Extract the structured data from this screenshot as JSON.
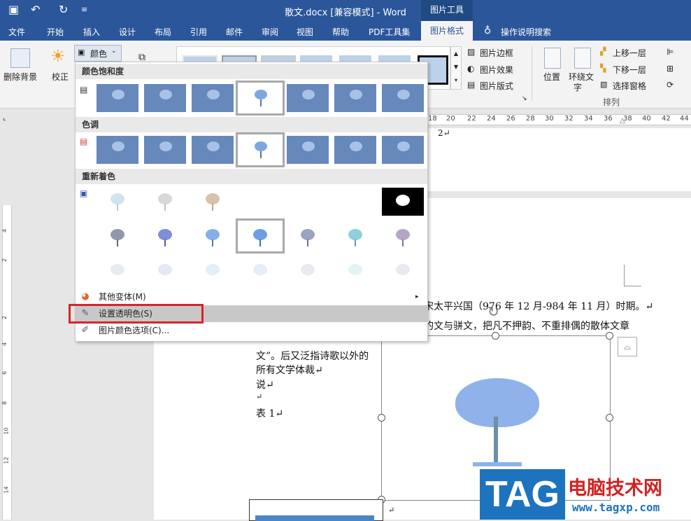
{
  "titlebar": {
    "doc_title": "散文.docx [兼容模式]  -  Word",
    "context_group": "图片工具"
  },
  "tabs": [
    "文件",
    "开始",
    "插入",
    "设计",
    "布局",
    "引用",
    "邮件",
    "审阅",
    "视图",
    "帮助",
    "PDF工具集"
  ],
  "active_tab": "图片格式",
  "tell_me": "操作说明搜索",
  "ribbon": {
    "remove_bg": "删除背景",
    "correct": "校正",
    "color": "颜色",
    "border": "图片边框",
    "effects": "图片效果",
    "layout": "图片版式",
    "position": "位置",
    "wrap_text_1": "环绕文",
    "wrap_text_2": "字",
    "bring_forward": "上移一层",
    "send_backward": "下移一层",
    "selection_pane": "选择窗格",
    "arrange_group": "排列"
  },
  "ruler_numbers": [
    "18",
    "20",
    "22",
    "24",
    "26",
    "28",
    "30",
    "32",
    "34",
    "36",
    "38",
    "40",
    "42",
    "44"
  ],
  "vruler_numbers": [
    "4",
    "2",
    "2",
    "4",
    "6",
    "8",
    "10",
    "12",
    "14"
  ],
  "dropdown": {
    "saturation_header": "颜色饱和度",
    "tone_header": "色调",
    "recolor_header": "重新着色",
    "more_variations": "其他变体(M)",
    "set_transparent": "设置透明色(S)",
    "color_options": "图片颜色选项(C)..."
  },
  "document": {
    "page_num": "2↵",
    "line1": "宋太平兴国（976 年 12 月-984 年 11 月）时期。↵",
    "line2": "的文与骈文，把凡不押韵、不重排偶的散体文章",
    "line3": "文”。后又泛指诗歌以外的",
    "line4": "所有文学体裁↵",
    "line5": "说↵",
    "line6": "↵",
    "line7": "表  1↵",
    "line8": "↵"
  },
  "watermark": {
    "tag": "TAG",
    "site_name": "电脑技术网",
    "url": "www.tagxp.com"
  },
  "colors": {
    "accent": "#2b579a",
    "highlight": "#d9232a",
    "thumb_blue": "#6688bb"
  }
}
